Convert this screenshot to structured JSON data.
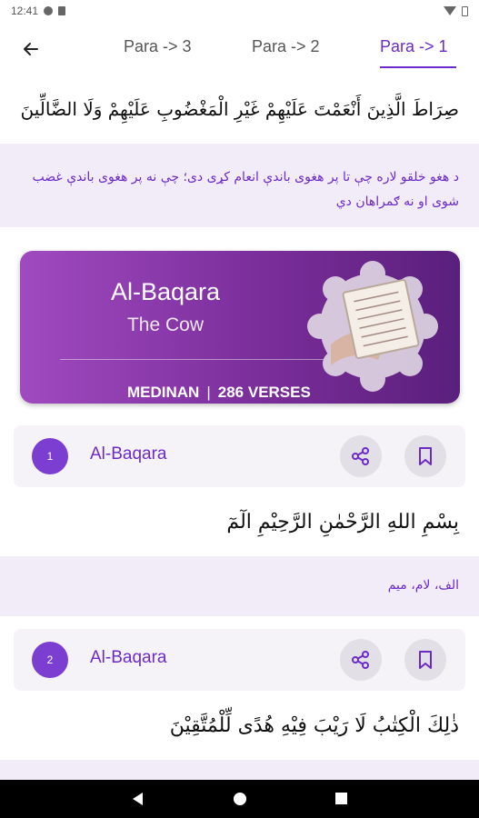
{
  "status": {
    "time": "12:41"
  },
  "tabs": [
    "Para -> 3",
    "Para -> 2",
    "Para -> 1"
  ],
  "ayah_top": {
    "arabic": "صِرَاطَ الَّذِينَ أَنْعَمْتَ عَلَيْهِمْ غَيْرِ الْمَغْضُوبِ عَلَيْهِمْ وَلَا الضَّالِّينَ",
    "translation": "د هغو خلقو لاره چې تا پر هغوی باندې انعام کړی دی؛ چې نه پر هغوی باندې غضب شوی او نه ګمراهان دي"
  },
  "banner": {
    "title": "Al-Baqara",
    "subtitle": "The Cow",
    "type": "MEDINAN",
    "separator": "|",
    "verses": "286 VERSES"
  },
  "verses": [
    {
      "number": "1",
      "surah": "Al-Baqara",
      "arabic": "بِسْمِ اللهِ الرَّحْمٰنِ الرَّحِيْمِ الٓمٓ",
      "translation": "الف، لام، میم"
    },
    {
      "number": "2",
      "surah": "Al-Baqara",
      "arabic": "ذٰلِكَ الْكِتٰبُ لَا رَيْبَ فِيْهِ هُدًى لِّلْمُتَّقِيْنَ",
      "translation": ""
    }
  ],
  "colors": {
    "accent": "#6b2bc9",
    "translation_bg": "#f2ecf8",
    "banner_start": "#a04ac0",
    "banner_end": "#5a1f7c"
  }
}
